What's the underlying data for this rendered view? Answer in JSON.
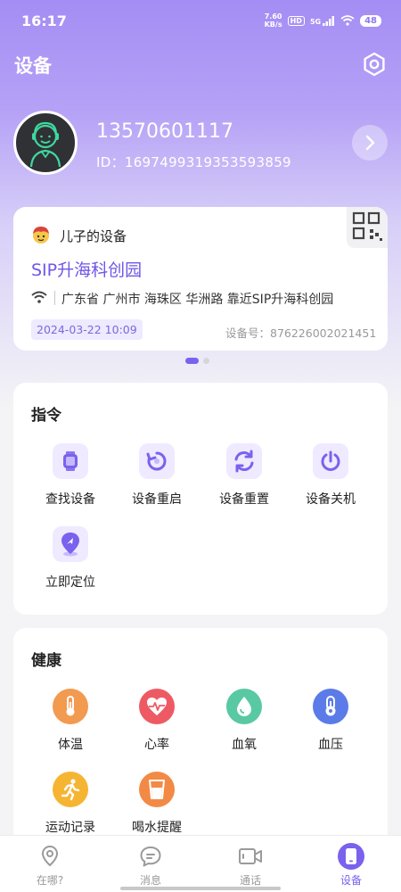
{
  "status_bar": {
    "time": "16:17",
    "net_speed_value": "7.60",
    "net_speed_unit": "KB/s",
    "hd": "HD",
    "network": "5G",
    "battery": "48"
  },
  "header": {
    "title": "设备",
    "settings_icon": "gear-hexagon-icon"
  },
  "profile": {
    "phone": "13570601117",
    "id_text": "ID：1697499319353593859",
    "arrow_icon": "chevron-right-icon"
  },
  "device_card": {
    "owner_label": "儿子的设备",
    "device_name": "SIP升海科创园",
    "location": "广东省 广州市 海珠区 华洲路 靠近SIP升海科创园",
    "date": "2024-03-22 10:09",
    "serial_text": "设备号：876226002021451"
  },
  "commands": {
    "title": "指令",
    "items": [
      {
        "label": "查找设备",
        "icon": "watch-icon"
      },
      {
        "label": "设备重启",
        "icon": "restart-icon"
      },
      {
        "label": "设备重置",
        "icon": "reset-icon"
      },
      {
        "label": "设备关机",
        "icon": "power-icon"
      },
      {
        "label": "立即定位",
        "icon": "locate-icon"
      }
    ]
  },
  "health": {
    "title": "健康",
    "items": [
      {
        "label": "体温",
        "icon": "thermometer-icon",
        "color": "#f29a4f"
      },
      {
        "label": "心率",
        "icon": "heart-rate-icon",
        "color": "#ee5a63"
      },
      {
        "label": "血氧",
        "icon": "droplet-icon",
        "color": "#58c9a3"
      },
      {
        "label": "血压",
        "icon": "pressure-icon",
        "color": "#5b7be8"
      },
      {
        "label": "运动记录",
        "icon": "running-icon",
        "color": "#f5b533"
      },
      {
        "label": "喝水提醒",
        "icon": "water-cup-icon",
        "color": "#f28a46"
      }
    ]
  },
  "bottom_nav": {
    "items": [
      {
        "label": "在哪?",
        "icon": "location-pin-icon",
        "active": false
      },
      {
        "label": "消息",
        "icon": "message-icon",
        "active": false
      },
      {
        "label": "通话",
        "icon": "video-call-icon",
        "active": false
      },
      {
        "label": "设备",
        "icon": "device-icon",
        "active": true
      }
    ]
  },
  "colors": {
    "accent": "#7a62ee",
    "header_gradient_top": "#a48df4"
  }
}
